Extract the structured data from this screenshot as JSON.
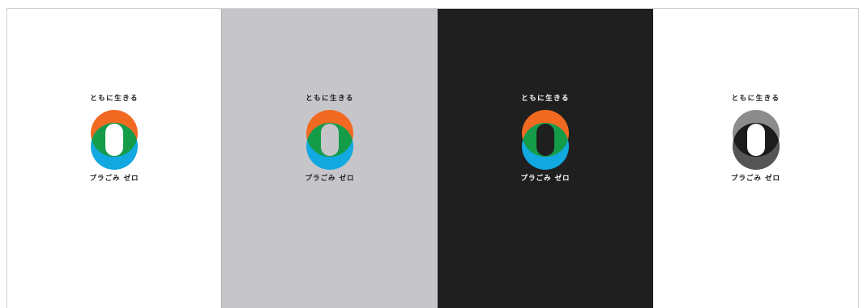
{
  "panels": [
    {
      "id": "white",
      "background": "#ffffff",
      "text_color": "#1a1a1a",
      "tagline": "ともに生きる",
      "brand": "プラごみ ゼロ",
      "logo": {
        "top": "#f26a21",
        "bottom": "#12a8e0",
        "overlap": "#149c48",
        "counter": "#ffffff"
      }
    },
    {
      "id": "gray",
      "background": "#c6c5ca",
      "text_color": "#1a1a1a",
      "tagline": "ともに生きる",
      "brand": "プラごみ ゼロ",
      "logo": {
        "top": "#f26a21",
        "bottom": "#12a8e0",
        "overlap": "#149c48",
        "counter": "#c6c5ca"
      }
    },
    {
      "id": "black",
      "background": "#1f1f1f",
      "text_color": "#ffffff",
      "tagline": "ともに生きる",
      "brand": "プラごみ ゼロ",
      "logo": {
        "top": "#f26a21",
        "bottom": "#12a8e0",
        "overlap": "#149c48",
        "counter": "#1f1f1f"
      }
    },
    {
      "id": "mono",
      "background": "#ffffff",
      "text_color": "#1a1a1a",
      "tagline": "ともに生きる",
      "brand": "プラごみ ゼロ",
      "logo": {
        "top": "#8c8c8c",
        "bottom": "#555555",
        "overlap": "#1c1c1c",
        "counter": "#ffffff"
      }
    }
  ]
}
